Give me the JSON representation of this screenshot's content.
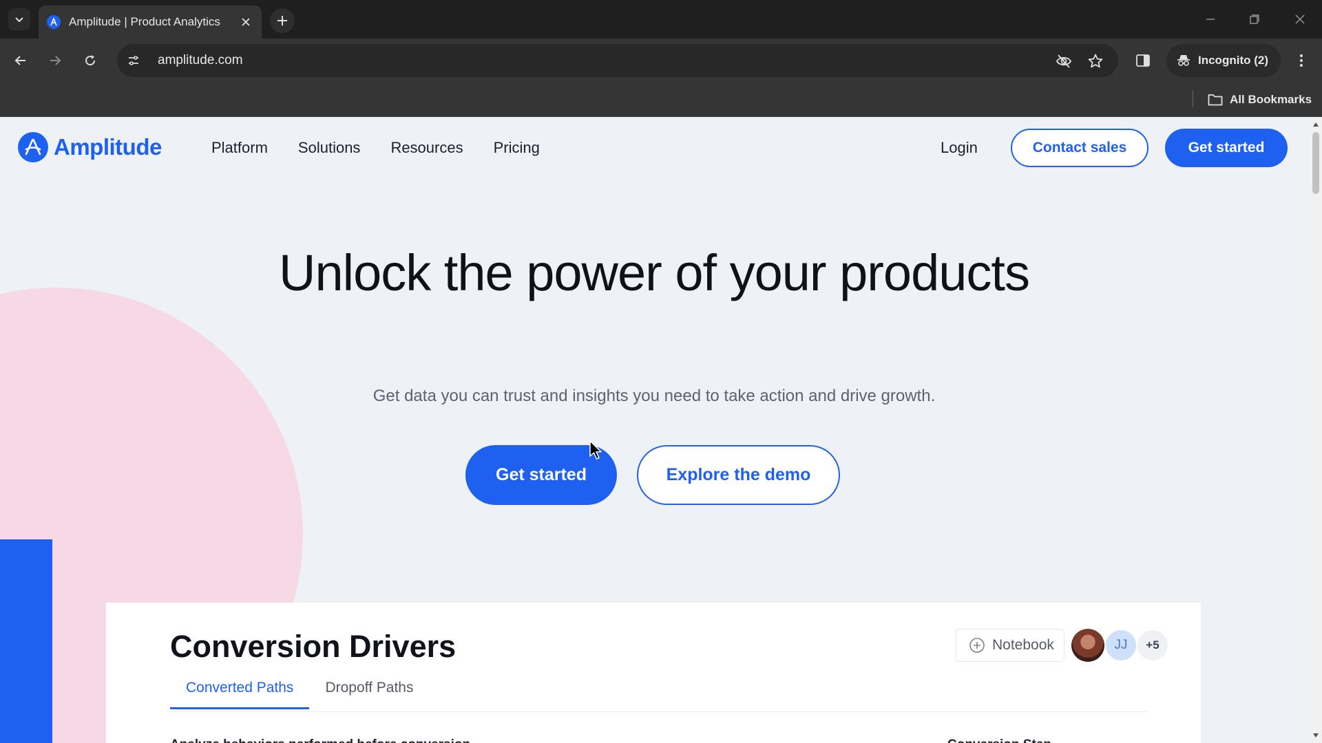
{
  "browser": {
    "tab_title": "Amplitude | Product Analytics",
    "url": "amplitude.com",
    "incognito_label": "Incognito (2)",
    "bookmarks_label": "All Bookmarks"
  },
  "site_nav": {
    "logo_text": "Amplitude",
    "items": [
      "Platform",
      "Solutions",
      "Resources",
      "Pricing"
    ],
    "login": "Login",
    "contact_sales": "Contact sales",
    "get_started": "Get started"
  },
  "hero": {
    "title": "Unlock the power of your products",
    "subtitle": "Get data you can trust and insights you need to take action and drive growth.",
    "primary_cta": "Get started",
    "secondary_cta": "Explore the demo"
  },
  "panel": {
    "title": "Conversion Drivers",
    "notebook_label": "Notebook",
    "avatar_initials": "JJ",
    "more_count": "+5",
    "tabs": [
      "Converted Paths",
      "Dropoff Paths"
    ],
    "active_tab": "Converted Paths",
    "caption_left": "Analyze behaviors performed before conversion",
    "caption_right": "Conversion Step"
  },
  "colors": {
    "brand_blue": "#1e61f0",
    "hero_bg": "#eef1f6",
    "decor_pink": "#f6d9e4"
  }
}
